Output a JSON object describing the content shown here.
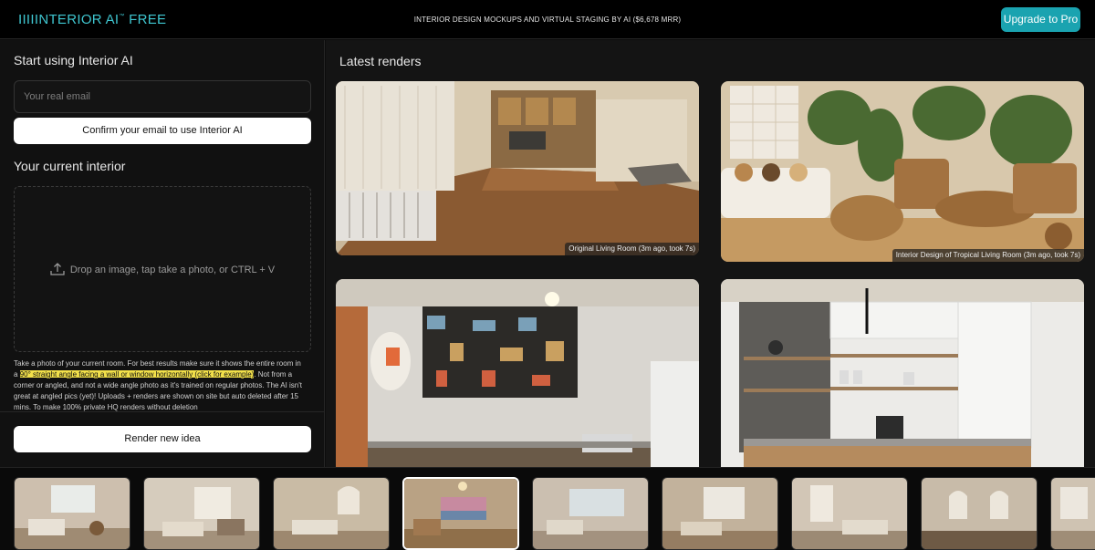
{
  "header": {
    "logo_text": "IIIIINTERIOR AI",
    "logo_tm": "™",
    "logo_free": "FREE",
    "tagline": "INTERIOR DESIGN MOCKUPS AND VIRTUAL STAGING BY AI ($6,678 MRR)",
    "upgrade_label": "Upgrade to Pro"
  },
  "left": {
    "start_title": "Start using Interior AI",
    "email_placeholder": "Your real email",
    "confirm_label": "Confirm your email to use Interior AI",
    "current_title": "Your current interior",
    "drop_text": "Drop an image, tap take a photo, or CTRL + V",
    "help_prefix": "Take a photo of your current room. For best results make sure it shows the entire room in a ",
    "help_link": "90° straight angle facing a wall or window horizontally (click for example)",
    "help_suffix": ". Not from a corner or angled, and not a wide angle photo as it's trained on regular photos. The AI isn't great at angled pics (yet)! Uploads + renders are shown on site but auto deleted after 15 mins. To make 100% private HQ renders without deletion",
    "render_label": "Render new idea"
  },
  "right": {
    "title": "Latest renders",
    "renders": [
      {
        "caption": "Original Living Room (3m ago, took 7s)"
      },
      {
        "caption": "Interior Design of Tropical Living Room (3m ago, took 7s)"
      },
      {
        "caption": ""
      },
      {
        "caption": ""
      }
    ]
  },
  "strip": {
    "thumbnails": 9,
    "active_index": 3
  },
  "colors": {
    "accent": "#1aa3b0",
    "logo": "#3fc6d0",
    "highlight": "#f2e04a",
    "background": "#0c0c0c"
  },
  "icons": [
    "upload-icon"
  ]
}
